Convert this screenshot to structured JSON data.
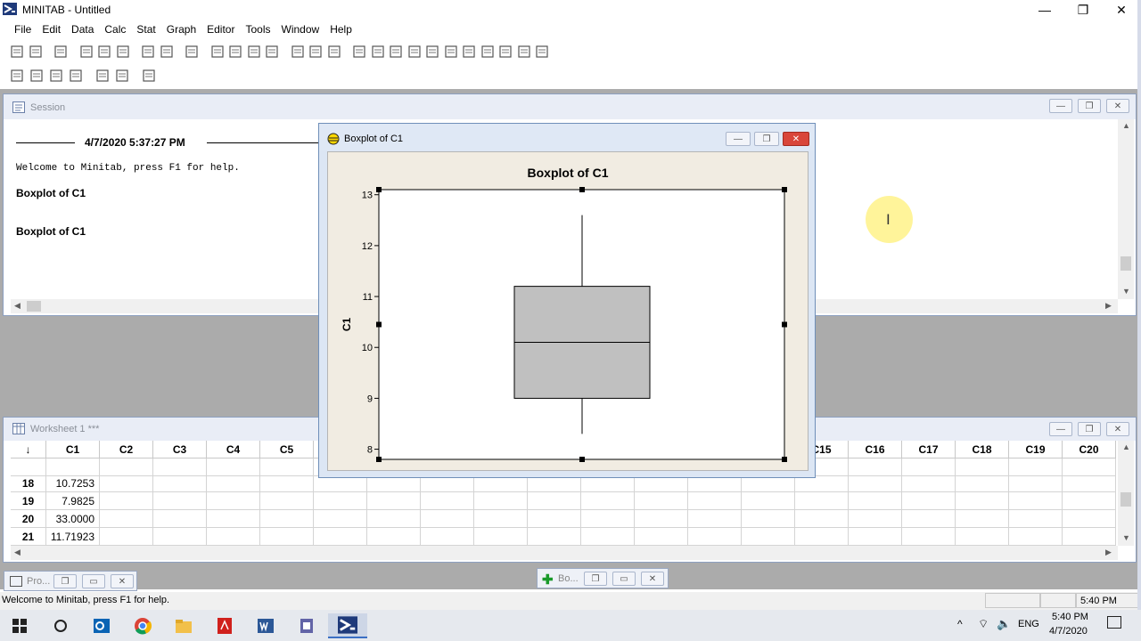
{
  "app": {
    "title": "MINITAB - Untitled"
  },
  "menu": [
    "File",
    "Edit",
    "Data",
    "Calc",
    "Stat",
    "Graph",
    "Editor",
    "Tools",
    "Window",
    "Help"
  ],
  "toolbar": {
    "row1": [
      "open-icon",
      "save-icon",
      "print-icon",
      "cut-icon",
      "copy-icon",
      "paste-icon",
      "undo-icon",
      "redo-icon",
      "edit-last-dialog-icon",
      "prev-icon",
      "next-icon",
      "find-icon",
      "find-next-icon",
      "cancel-icon",
      "help-icon",
      "stat-guide-icon",
      "session-icon",
      "worksheet-icon",
      "graph-icon",
      "info-icon",
      "history-icon",
      "report-icon",
      "related-icon",
      "project-manager-icon",
      "columns-icon",
      "rows-icon",
      "manage-graphs-icon"
    ],
    "row2": [
      "insert-cells-icon",
      "insert-rows-icon",
      "insert-columns-icon",
      "move-columns-icon",
      "brush-icon",
      "set-id-icon",
      "erase-icon"
    ]
  },
  "session": {
    "title": "Session",
    "timestamp": "4/7/2020 5:37:27 PM",
    "welcome": "Welcome to Minitab, press F1 for help.",
    "entries": [
      "Boxplot of C1",
      "Boxplot of C1"
    ]
  },
  "worksheet": {
    "title": "Worksheet 1 ***",
    "corner": "↓",
    "columns": [
      "C1",
      "C2",
      "C3",
      "C4",
      "C5",
      "",
      "",
      "",
      "",
      "",
      "",
      "",
      "",
      "",
      "C15",
      "C16",
      "C17",
      "C18",
      "C19",
      "C20"
    ],
    "rows": [
      {
        "n": "18",
        "c1": "10.7253"
      },
      {
        "n": "19",
        "c1": "7.9825"
      },
      {
        "n": "20",
        "c1": "33.0000"
      },
      {
        "n": "21",
        "c1": "11.71923"
      }
    ]
  },
  "graph_window": {
    "title": "Boxplot of C1"
  },
  "chart_data": {
    "type": "box",
    "title": "Boxplot of C1",
    "ylabel": "C1",
    "ylim": [
      7.8,
      13.1
    ],
    "yticks": [
      8,
      9,
      10,
      11,
      12,
      13
    ],
    "box": {
      "whisker_low": 8.3,
      "q1": 9.0,
      "median": 10.1,
      "q3": 11.2,
      "whisker_high": 12.6
    },
    "box_color": "#c0c0c0"
  },
  "minimized": {
    "project": "Pro...",
    "graph": "Bo..."
  },
  "statusbar": {
    "message": "Welcome to Minitab, press F1 for help.",
    "time": "5:40 PM"
  },
  "taskbar": {
    "lang": "ENG",
    "time": "5:40 PM",
    "date": "4/7/2020"
  }
}
